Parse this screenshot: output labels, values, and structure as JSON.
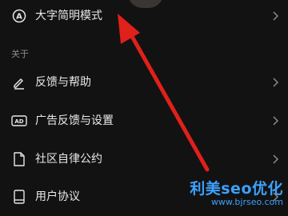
{
  "rows": {
    "font_mode": {
      "label": "大字简明模式",
      "icon": "text-a-icon"
    },
    "feedback": {
      "label": "反馈与帮助",
      "icon": "pencil-icon"
    },
    "ad_feedback": {
      "label": "广告反馈与设置",
      "icon": "ad-icon"
    },
    "community": {
      "label": "社区自律公约",
      "icon": "document-icon"
    },
    "user_agreement": {
      "label": "用户协议",
      "icon": "book-icon"
    }
  },
  "section": {
    "about": "关于"
  },
  "watermark": {
    "title": "利美seo优化",
    "url": "www.bjrseo.com"
  },
  "colors": {
    "background": "#121212",
    "arrow": "#e0201a",
    "watermark": "#3da1ff"
  }
}
